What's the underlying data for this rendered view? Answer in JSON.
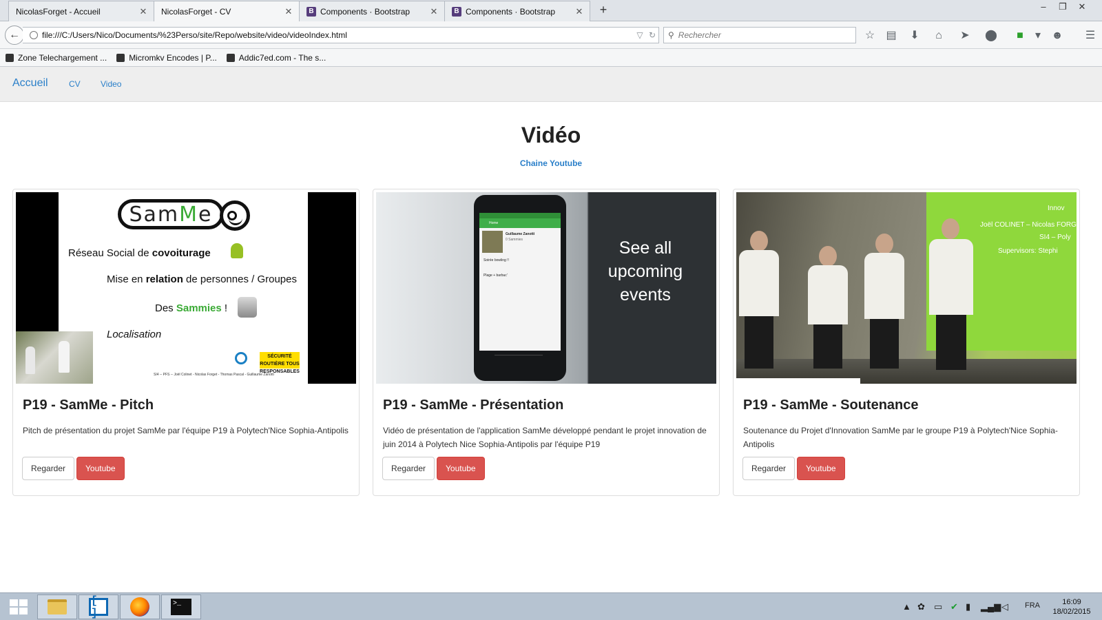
{
  "browser": {
    "tabs": [
      {
        "title": "NicolasForget - Accueil",
        "active": false,
        "favicon": "none"
      },
      {
        "title": "NicolasForget - CV",
        "active": true,
        "favicon": "none"
      },
      {
        "title": "Components · Bootstrap",
        "active": false,
        "favicon": "bootstrap-icon"
      },
      {
        "title": "Components · Bootstrap",
        "active": false,
        "favicon": "bootstrap-icon"
      }
    ],
    "url": "file:///C:/Users/Nico/Documents/%23Perso/site/Repo/website/video/videoIndex.html",
    "search_placeholder": "Rechercher",
    "bookmarks": [
      {
        "label": "Zone Telechargement ..."
      },
      {
        "label": "Micromkv Encodes | P..."
      },
      {
        "label": "Addic7ed.com - The s..."
      }
    ]
  },
  "site_nav": {
    "brand": "Accueil",
    "links": [
      "CV",
      "Video"
    ]
  },
  "header": {
    "title": "Vidéo",
    "channel_link": "Chaine Youtube"
  },
  "cards": [
    {
      "title": "P19 - SamMe - Pitch",
      "description": "Pitch de présentation du projet SamMe par l'équipe P19 à Polytech'Nice Sophia-Antipolis",
      "watch_label": "Regarder",
      "youtube_label": "Youtube",
      "thumbnail": {
        "logo": "SamMe",
        "lines": [
          {
            "pre": "Réseau Social de ",
            "bold": "covoiturage",
            "post": ""
          },
          {
            "pre": "Mise en ",
            "bold": "relation",
            "post": " de personnes / Groupes"
          },
          {
            "pre": "Des ",
            "bold": "Sammies",
            "post": " !"
          },
          {
            "pre": "Localisation",
            "bold": "",
            "post": ""
          }
        ],
        "badge": "SÉCURITÉ ROUTIÈRE TOUS RESPONSABLES",
        "footer": "SI4 -- PFS -- Joël Colinet - Nicolas Forget - Thomas Pascal - Guillaume Zanotti"
      }
    },
    {
      "title": "P19 - SamMe - Présentation",
      "description": "Vidéo de présentation de l'application SamMe développé pendant le projet innovation de juin 2014 à Polytech Nice Sophia-Antipolis par l'équipe P19",
      "watch_label": "Regarder",
      "youtube_label": "Youtube",
      "thumbnail": {
        "caption": "See all upcoming events",
        "app_bar": "Home",
        "user_name": "Guillaume Zanotti",
        "user_sub": "0 Sammies",
        "event1": "Soirée bowling !!",
        "event2": "Plage + barbuc'"
      }
    },
    {
      "title": "P19 - SamMe - Soutenance",
      "description": "Soutenance du Projet d'Innovation SamMe par le groupe P19 à Polytech'Nice Sophia-Antipolis",
      "watch_label": "Regarder",
      "youtube_label": "Youtube",
      "thumbnail": {
        "screen_lines": [
          "Innov",
          "Joël COLINET – Nicolas FORGET –",
          "SI4 – Poly",
          "Supervisors: Stephi"
        ]
      }
    }
  ],
  "taskbar": {
    "language": "FRA",
    "time": "16:09",
    "date": "18/02/2015"
  },
  "colors": {
    "link": "#2a7fc9",
    "danger": "#d9534f",
    "site_nav_bg": "#eeeeee",
    "taskbar_bg": "#b6c3d1"
  }
}
